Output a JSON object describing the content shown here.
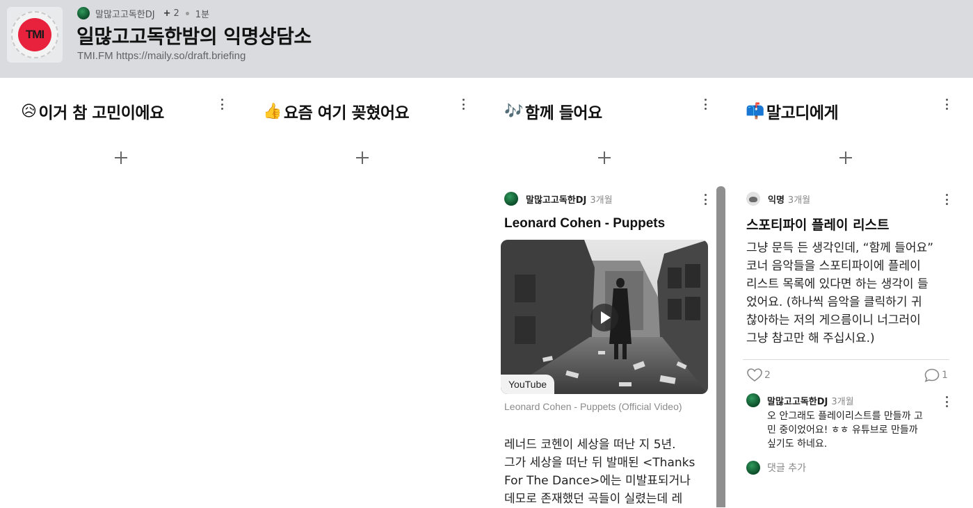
{
  "header": {
    "author": "말많고고독한DJ",
    "contributor_count": "2",
    "time_ago": "1분",
    "board_title": "일많고고독한밤의 익명상담소",
    "subtitle": "TMI.FM https://maily.so/draft.briefing",
    "logo_text": "TMI",
    "logo_color": "#e8213d"
  },
  "columns": [
    {
      "emoji": "😥",
      "title": "이거 참 고민이에요"
    },
    {
      "emoji": "👍",
      "title": "요즘 여기 꽂혔어요"
    },
    {
      "emoji": "🎶",
      "title": "함께 들어요"
    },
    {
      "emoji": "📫",
      "title": "말고디에게"
    }
  ],
  "music_post": {
    "author": "말많고고독한DJ",
    "time": "3개월",
    "title": "Leonard Cohen - Puppets",
    "video_source": "YouTube",
    "video_caption": "Leonard Cohen - Puppets (Official Video)",
    "body_lines": [
      "레너드 코헨이 세상을 떠난 지 5년.",
      "그가 세상을 떠난 뒤 발매된 <Thanks",
      "For The Dance>에는 미발표되거나",
      "데모로 존재했던 곡들이 실렸는데 레"
    ]
  },
  "letter_post": {
    "author": "익명",
    "time": "3개월",
    "title": "스포티파이 플레이 리스트",
    "body_lines": [
      "그냥 문득 든 생각인데, “함께 들어요”",
      "코너 음악들을 스포티파이에 플레이",
      "리스트 목록에 있다면 하는 생각이 들",
      "었어요. (하나씩 음악을 클릭하기 귀",
      "찮아하는 저의 게으름이니 너그러이",
      "그냥 참고만 해 주십시요.)"
    ],
    "likes": "2",
    "comments": "1",
    "comment": {
      "author": "말많고고독한DJ",
      "time": "3개월",
      "text_lines": [
        "오 안그래도 플레이리스트를 만들까 고",
        "민 중이었어요! ㅎㅎ 유튜브로 만들까",
        "싶기도 하네요."
      ]
    },
    "add_comment_label": "댓글 추가"
  },
  "icons": {
    "kebab": "more-vertical-icon",
    "add": "plus-icon",
    "like": "heart-icon",
    "comment": "comment-bubble-icon",
    "play": "play-icon"
  }
}
